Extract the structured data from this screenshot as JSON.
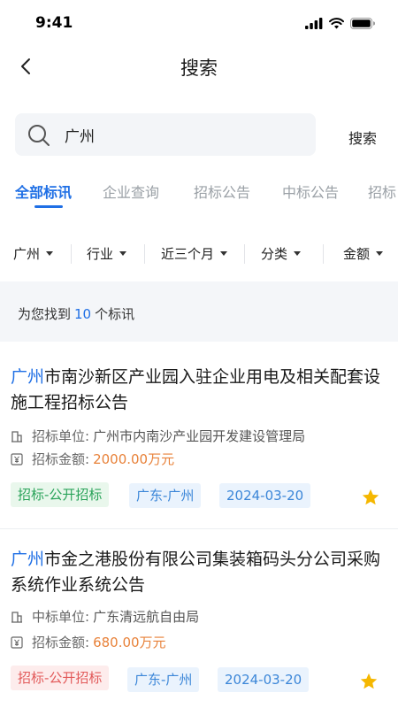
{
  "status_bar": {
    "time": "9:41"
  },
  "nav": {
    "title": "搜索"
  },
  "search": {
    "value": "广州",
    "button_label": "搜索"
  },
  "tabs": [
    {
      "label": "全部标讯",
      "active": true
    },
    {
      "label": "企业查询",
      "active": false
    },
    {
      "label": "招标公告",
      "active": false
    },
    {
      "label": "中标公告",
      "active": false
    },
    {
      "label": "招标",
      "active": false
    }
  ],
  "filters": [
    {
      "label": "广州"
    },
    {
      "label": "行业"
    },
    {
      "label": "近三个月"
    },
    {
      "label": "分类"
    },
    {
      "label": "金额"
    }
  ],
  "result": {
    "prefix": "为您找到",
    "count": "10",
    "suffix": "个标讯"
  },
  "cards": [
    {
      "title_highlight": "广州",
      "title_rest": "市南沙新区产业园入驻企业用电及相关配套设施工程招标公告",
      "unit_label": "招标单位:",
      "unit_value": "广州市内南沙产业园开发建设管理局",
      "amount_label": "招标金额:",
      "amount_value": "2000.00万元",
      "tags": [
        "招标-公开招标",
        "广东-广州",
        "2024-03-20"
      ],
      "starred": true
    },
    {
      "title_highlight": "广州",
      "title_rest": "市金之港股份有限公司集装箱码头分公司采购系统作业系统公告",
      "unit_label": "中标单位:",
      "unit_value": "广东清远航自由局",
      "amount_label": "招标金额:",
      "amount_value": "680.00万元",
      "tags": [
        "招标-公开招标",
        "广东-广州",
        "2024-03-20"
      ],
      "starred": true
    }
  ],
  "colors": {
    "accent": "#1f6fe5",
    "amount": "#e8823a",
    "star": "#f5b700"
  }
}
